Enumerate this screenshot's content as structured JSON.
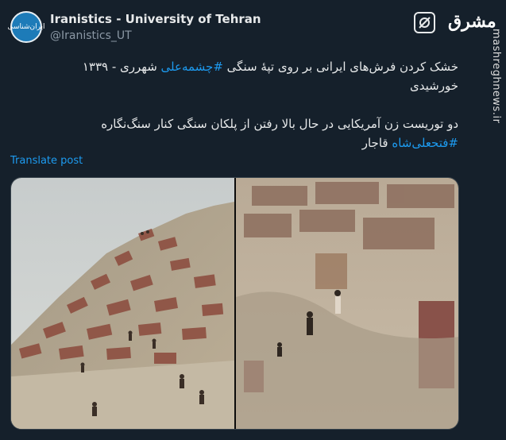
{
  "account": {
    "display_name": "Iranistics - University of Tehran",
    "handle": "@Iranistics_UT",
    "avatar_icon": "university-seal-icon",
    "avatar_text": "ایران‌شناسی"
  },
  "grok_button": {
    "icon": "grok-icon"
  },
  "watermark": {
    "logo": "مشرق",
    "site": "mashreghnews.ir"
  },
  "post": {
    "line1_before": "خشک کردن فرش‌های ایرانی بر روی تپهٔ سنگی ",
    "line1_hashtag": "#چشمه‌علی",
    "line1_after": " شهرری - ۱۳۳۹ خورشیدی",
    "line2": "دو توریست زن آمریکایی در حال بالا رفتن از پلکان سنگی کنار سنگ‌نگاره ",
    "line2_hashtag": "#فتحعلی‌شاه",
    "line2_after": " قاجار"
  },
  "translate_label": "Translate post",
  "colors": {
    "background": "#15202b",
    "text": "#e7e9ea",
    "secondary": "#8b98a5",
    "link": "#1d9bf0"
  }
}
